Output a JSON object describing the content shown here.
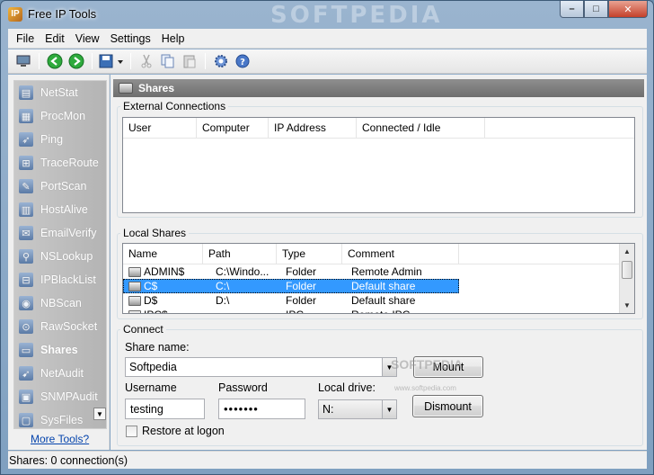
{
  "window": {
    "title": "Free IP Tools",
    "watermark": "SOFTPEDIA",
    "minimize": "–",
    "maximize": "□",
    "close": "✕"
  },
  "menu": [
    "File",
    "Edit",
    "View",
    "Settings",
    "Help"
  ],
  "toolbar": {
    "icons": [
      "monitor-icon",
      "back-icon",
      "forward-icon",
      "save-icon",
      "cut-icon",
      "copy-icon",
      "paste-icon",
      "settings-icon",
      "help-icon"
    ]
  },
  "sidebar": {
    "items": [
      {
        "label": "NetStat",
        "icon": "netstat-icon",
        "glyph": "▤"
      },
      {
        "label": "ProcMon",
        "icon": "procmon-icon",
        "glyph": "▦"
      },
      {
        "label": "Ping",
        "icon": "ping-icon",
        "glyph": "➶"
      },
      {
        "label": "TraceRoute",
        "icon": "traceroute-icon",
        "glyph": "⊞"
      },
      {
        "label": "PortScan",
        "icon": "portscan-icon",
        "glyph": "✎"
      },
      {
        "label": "HostAlive",
        "icon": "hostalive-icon",
        "glyph": "▥"
      },
      {
        "label": "EmailVerify",
        "icon": "emailverify-icon",
        "glyph": "✉"
      },
      {
        "label": "NSLookup",
        "icon": "nslookup-icon",
        "glyph": "⚲"
      },
      {
        "label": "IPBlackList",
        "icon": "ipblacklist-icon",
        "glyph": "⊟"
      },
      {
        "label": "NBScan",
        "icon": "nbscan-icon",
        "glyph": "◉"
      },
      {
        "label": "RawSocket",
        "icon": "rawsocket-icon",
        "glyph": "⊙"
      },
      {
        "label": "Shares",
        "icon": "shares-icon",
        "glyph": "▭",
        "active": true
      },
      {
        "label": "NetAudit",
        "icon": "netaudit-icon",
        "glyph": "➹"
      },
      {
        "label": "SNMPAudit",
        "icon": "snmpaudit-icon",
        "glyph": "▣"
      },
      {
        "label": "SysFiles",
        "icon": "sysfiles-icon",
        "glyph": "▢"
      }
    ],
    "more_tools": "More Tools?"
  },
  "panel": {
    "title": "Shares"
  },
  "external_connections": {
    "label": "External Connections",
    "columns": [
      "User",
      "Computer",
      "IP Address",
      "Connected / Idle"
    ],
    "rows": []
  },
  "local_shares": {
    "label": "Local Shares",
    "columns": [
      "Name",
      "Path",
      "Type",
      "Comment"
    ],
    "rows": [
      {
        "name": "ADMIN$",
        "path": "C:\\Windo...",
        "type": "Folder",
        "comment": "Remote Admin",
        "selected": false
      },
      {
        "name": "C$",
        "path": "C:\\",
        "type": "Folder",
        "comment": "Default share",
        "selected": true
      },
      {
        "name": "D$",
        "path": "D:\\",
        "type": "Folder",
        "comment": "Default share",
        "selected": false
      },
      {
        "name": "IPC$",
        "path": "",
        "type": "IPC",
        "comment": "Remote IPC",
        "selected": false
      }
    ]
  },
  "connect": {
    "label": "Connect",
    "share_name_label": "Share name:",
    "share_name_value": "Softpedia",
    "mount_button": "Mount",
    "username_label": "Username",
    "username_value": "testing",
    "password_label": "Password",
    "password_value": "•••••••",
    "local_drive_label": "Local drive:",
    "local_drive_value": "N:",
    "dismount_button": "Dismount",
    "restore_label": "Restore at logon"
  },
  "watermark_logo": {
    "text": "SOFTPEDIA",
    "url": "www.softpedia.com"
  },
  "status": {
    "text": "Shares: 0 connection(s)"
  }
}
